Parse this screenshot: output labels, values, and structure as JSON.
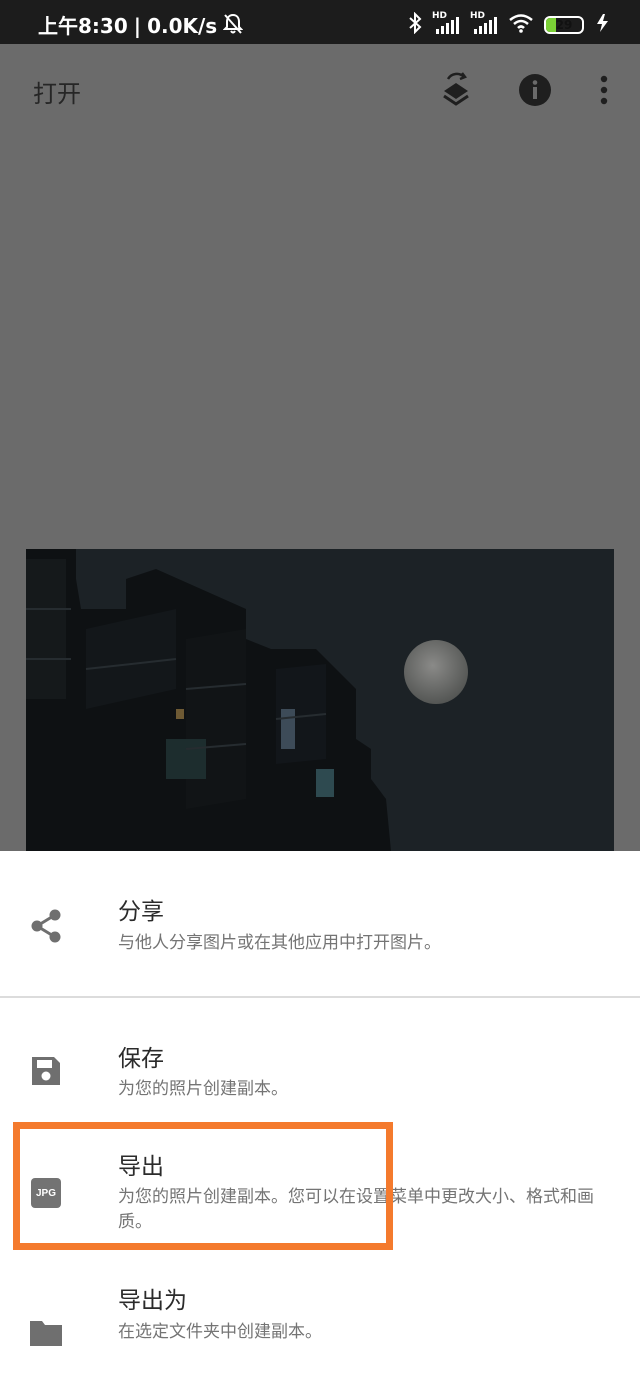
{
  "status_bar": {
    "time": "上午8:30",
    "separator": "|",
    "network_speed": "0.0K/s",
    "mute_icon": "bell-off-icon",
    "bluetooth_icon": "bluetooth-icon",
    "signal_label_1": "HD",
    "signal_label_2": "HD",
    "wifi_icon": "wifi-icon",
    "battery_level": "29",
    "battery_fraction": 0.29,
    "charging_icon": "charging-icon"
  },
  "app_bar": {
    "title": "打开",
    "actions": [
      "layers-icon",
      "info-icon",
      "more-vert-icon"
    ]
  },
  "colors": {
    "scrim": "#6b6b6b",
    "highlight": "#f47a2d",
    "sheet": "#ffffff",
    "icon": "#6f6f6f"
  },
  "sheet": {
    "items": [
      {
        "icon": "share-icon",
        "title": "分享",
        "description": "与他人分享图片或在其他应用中打开图片。"
      },
      {
        "icon": "save-icon",
        "title": "保存",
        "description": "为您的照片创建副本。"
      },
      {
        "icon": "jpg-icon",
        "icon_label": "JPG",
        "title": "导出",
        "description": "为您的照片创建副本。您可以在设置菜单中更改大小、格式和画质。"
      },
      {
        "icon": "folder-icon",
        "title": "导出为",
        "description": "在选定文件夹中创建副本。"
      }
    ]
  }
}
